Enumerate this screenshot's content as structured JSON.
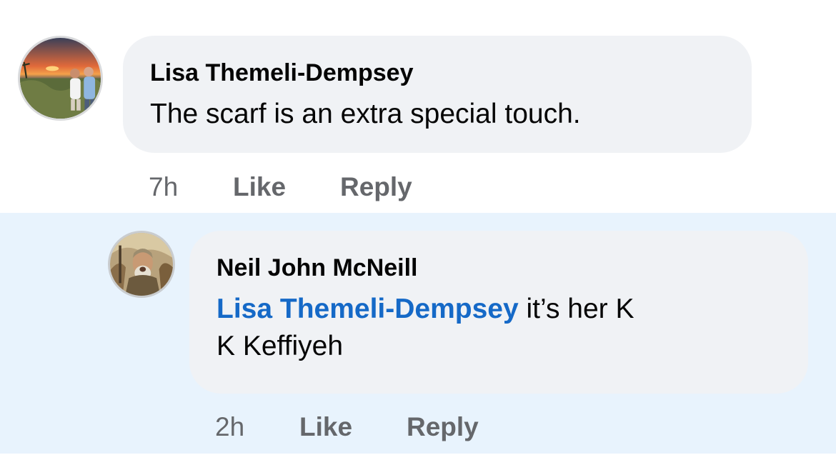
{
  "comments": [
    {
      "author": "Lisa Themeli-Dempsey",
      "text": "The scarf is an extra special touch.",
      "time": "7h",
      "like_label": "Like",
      "reply_label": "Reply",
      "avatar_icon": "sunset-couple-photo-avatar"
    }
  ],
  "replies": [
    {
      "author": "Neil John McNeill",
      "mention": "Lisa Themeli-Dempsey",
      "text_line1": " it’s her K",
      "text_line2": "K Keffiyeh",
      "time": "2h",
      "like_label": "Like",
      "reply_label": "Reply",
      "avatar_icon": "painted-warrior-avatar"
    }
  ],
  "colors": {
    "bubble": "#f0f2f5",
    "reply_highlight": "#e8f3fd",
    "mention": "#1569c7",
    "meta_text": "#65676b"
  }
}
